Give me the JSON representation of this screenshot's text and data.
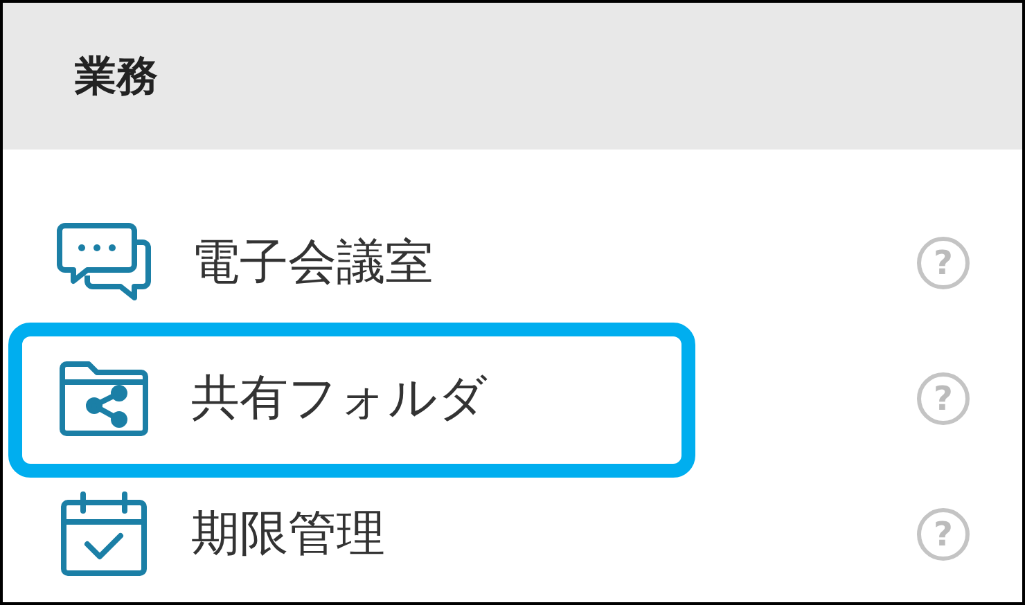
{
  "section": {
    "title": "業務"
  },
  "items": [
    {
      "kind": "chat",
      "label": "電子会議室",
      "help": "?",
      "highlighted": false
    },
    {
      "kind": "folder",
      "label": "共有フォルダ",
      "help": "?",
      "highlighted": true
    },
    {
      "kind": "calendar",
      "label": "期限管理",
      "help": "?",
      "highlighted": false
    }
  ]
}
